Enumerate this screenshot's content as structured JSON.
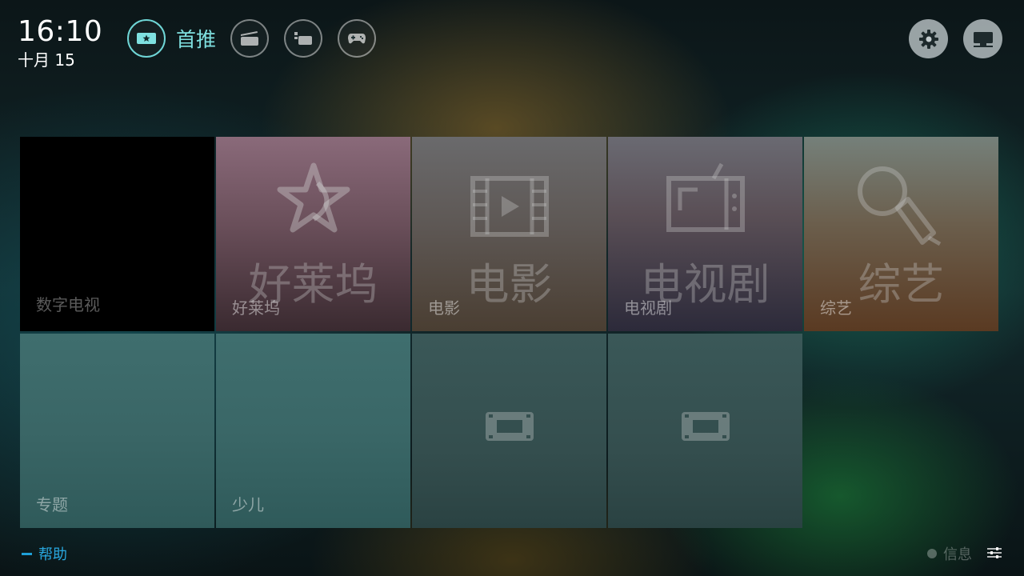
{
  "clock": {
    "time": "16:10",
    "date": "十月 15"
  },
  "nav": {
    "items": [
      {
        "label": "首推",
        "icon": "star-ticket-icon",
        "active": true
      },
      {
        "label": "",
        "icon": "clapperboard-icon",
        "active": false
      },
      {
        "label": "",
        "icon": "tv-folder-icon",
        "active": false
      },
      {
        "label": "",
        "icon": "gamepad-icon",
        "active": false
      }
    ]
  },
  "top_right": {
    "settings_icon": "gear-icon",
    "screen_icon": "monitor-icon"
  },
  "tiles": {
    "digital_tv": {
      "label": "数字电视"
    },
    "hollywood": {
      "label": "好莱坞",
      "big": "好莱坞",
      "icon": "star-icon"
    },
    "movie": {
      "label": "电影",
      "big": "电影",
      "icon": "film-icon"
    },
    "tv_series": {
      "label": "电视剧",
      "big": "电视剧",
      "icon": "tv-icon"
    },
    "variety": {
      "label": "综艺",
      "big": "综艺",
      "icon": "microphone-icon"
    },
    "topic": {
      "label": "专题"
    },
    "kids": {
      "label": "少儿"
    },
    "placeholder_1": {
      "icon": "film-placeholder-icon"
    },
    "placeholder_2": {
      "icon": "film-placeholder-icon"
    }
  },
  "footer": {
    "help": "帮助",
    "info": "信息",
    "menu_icon": "sliders-icon"
  },
  "colors": {
    "accent": "#6fd6d6",
    "help_blue": "#29a8e0"
  }
}
